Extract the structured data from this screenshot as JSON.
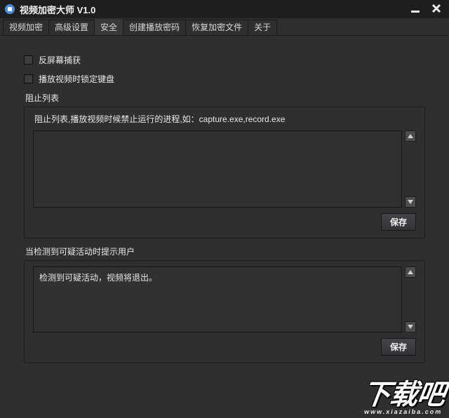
{
  "title": "视频加密大师 V1.0",
  "tabs": [
    {
      "label": "视频加密",
      "active": false
    },
    {
      "label": "高级设置",
      "active": false
    },
    {
      "label": "安全",
      "active": true
    },
    {
      "label": "创建播放密码",
      "active": false
    },
    {
      "label": "恢复加密文件",
      "active": false
    },
    {
      "label": "关于",
      "active": false
    }
  ],
  "checkboxes": {
    "anti_capture": {
      "label": "反屏幕捕获",
      "checked": false
    },
    "lock_keyboard": {
      "label": "播放视频时锁定键盘",
      "checked": false
    }
  },
  "block_list": {
    "title": "阻止列表",
    "hint": "阻止列表,播放视频时候禁止运行的进程,如：capture.exe,record.exe",
    "value": "",
    "save": "保存"
  },
  "suspicious": {
    "title": "当检测到可疑活动时提示用户",
    "value": "检测到可疑活动，视频将退出。",
    "save": "保存"
  },
  "watermark": {
    "cn": "下载吧",
    "en": "www.xiazaiba.com"
  }
}
